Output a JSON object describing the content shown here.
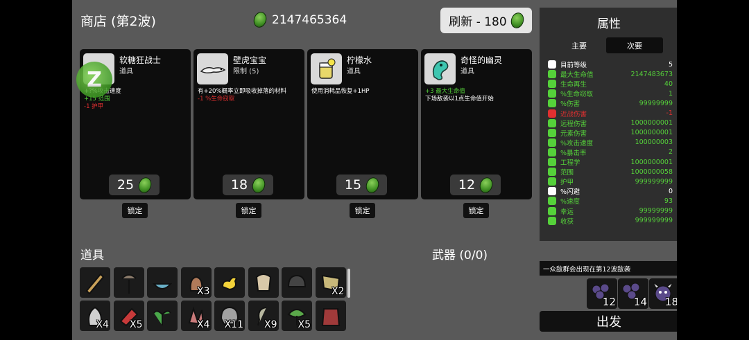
{
  "shop": {
    "title": "商店 (第2波)",
    "materials": "2147465364",
    "refresh": "刷新 - 180"
  },
  "cards": [
    {
      "name": "软糖狂战士",
      "type": "道具",
      "lines": [
        [
          "",
          "+?%攻击速度"
        ],
        [
          "g",
          "+15 范围"
        ],
        [
          "r",
          "-1 护甲"
        ]
      ],
      "price": "25",
      "lock": "锁定"
    },
    {
      "name": "壁虎宝宝",
      "type": "限制 (5)",
      "lines": [
        [
          "",
          "有+20%概率立即吸收掉落的材料"
        ],
        [
          "r",
          "-1 %生命窃取"
        ]
      ],
      "price": "18",
      "lock": "锁定"
    },
    {
      "name": "柠檬水",
      "type": "道具",
      "lines": [
        [
          "",
          "使用消耗品恢复+1HP"
        ]
      ],
      "price": "15",
      "lock": "锁定"
    },
    {
      "name": "奇怪的幽灵",
      "type": "道具",
      "lines": [
        [
          "g",
          "+3 最大生命值"
        ],
        [
          "",
          "下场敌袭以1点生命值开始"
        ]
      ],
      "price": "12",
      "lock": "锁定"
    }
  ],
  "items_title": "道具",
  "weapons_title": "武器 (0/0)",
  "inventory": [
    {
      "icon": "pencil-icon",
      "count": ""
    },
    {
      "icon": "palm-tree-icon",
      "count": ""
    },
    {
      "icon": "bowl-icon",
      "count": ""
    },
    {
      "icon": "teddy-icon",
      "count": "X3"
    },
    {
      "icon": "duck-icon",
      "count": ""
    },
    {
      "icon": "skull-mask-icon",
      "count": ""
    },
    {
      "icon": "beanie-icon",
      "count": ""
    },
    {
      "icon": "map-icon",
      "count": "X2"
    },
    {
      "icon": "ghost-icon",
      "count": "X4"
    },
    {
      "icon": "dynamite-icon",
      "count": "X5"
    },
    {
      "icon": "sprout-icon",
      "count": ""
    },
    {
      "icon": "claw-icon",
      "count": "X4"
    },
    {
      "icon": "helmet-icon",
      "count": "X11"
    },
    {
      "icon": "scythe-icon",
      "count": "X9"
    },
    {
      "icon": "tree-icon",
      "count": "X5"
    },
    {
      "icon": "jacket-icon",
      "count": ""
    }
  ],
  "stats": {
    "title": "属性",
    "tab_primary": "主要",
    "tab_secondary": "次要",
    "rows": [
      {
        "label": "目前等级",
        "value": "5",
        "color": "#ffffff"
      },
      {
        "label": "最大生命值",
        "value": "2147483673",
        "color": "#55d13a"
      },
      {
        "label": "生命再生",
        "value": "40",
        "color": "#55d13a"
      },
      {
        "label": "%生命窃取",
        "value": "1",
        "color": "#55d13a"
      },
      {
        "label": "%伤害",
        "value": "99999999",
        "color": "#55d13a"
      },
      {
        "label": "近战伤害",
        "value": "-1",
        "color": "#e03030"
      },
      {
        "label": "远程伤害",
        "value": "1000000001",
        "color": "#55d13a"
      },
      {
        "label": "元素伤害",
        "value": "1000000001",
        "color": "#55d13a"
      },
      {
        "label": "%攻击速度",
        "value": "100000003",
        "color": "#55d13a"
      },
      {
        "label": "%暴击率",
        "value": "2",
        "color": "#55d13a"
      },
      {
        "label": "工程学",
        "value": "1000000001",
        "color": "#55d13a"
      },
      {
        "label": "范围",
        "value": "1000000058",
        "color": "#55d13a"
      },
      {
        "label": "护甲",
        "value": "999999999",
        "color": "#55d13a"
      },
      {
        "label": "%闪避",
        "value": "0",
        "color": "#ffffff"
      },
      {
        "label": "%速度",
        "value": "93",
        "color": "#55d13a"
      },
      {
        "label": "幸运",
        "value": "99999999",
        "color": "#55d13a"
      },
      {
        "label": "收获",
        "value": "999999999",
        "color": "#55d13a"
      }
    ]
  },
  "wave_banner": "一众敌群会出现在第12波敌袭",
  "enemies": [
    {
      "count": "12"
    },
    {
      "count": "14"
    },
    {
      "count": "18"
    }
  ],
  "go_label": "出发",
  "ad_badge": "Z"
}
